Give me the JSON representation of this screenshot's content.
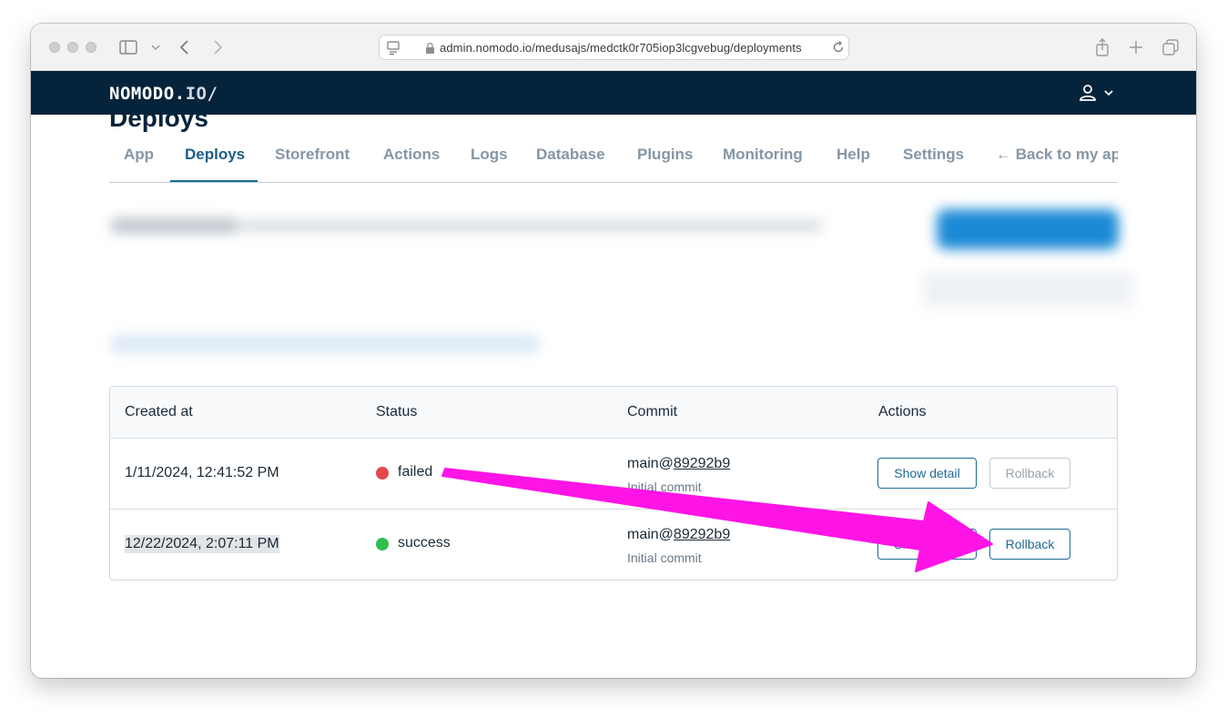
{
  "browser": {
    "url": "admin.nomodo.io/medusajs/medctk0r705iop3lcgvebug/deployments"
  },
  "app": {
    "logo_main": "NOMODO.",
    "logo_accent": "IO/"
  },
  "page": {
    "heading": "Deploys"
  },
  "tabs": [
    {
      "label": "App"
    },
    {
      "label": "Deploys"
    },
    {
      "label": "Storefront"
    },
    {
      "label": "Actions"
    },
    {
      "label": "Logs"
    },
    {
      "label": "Database"
    },
    {
      "label": "Plugins"
    },
    {
      "label": "Monitoring"
    },
    {
      "label": "Help"
    },
    {
      "label": "Settings"
    },
    {
      "label": "← Back to my ap"
    }
  ],
  "table": {
    "headers": [
      "Created at",
      "Status",
      "Commit",
      "Actions"
    ],
    "rows": [
      {
        "created_at": "1/11/2024, 12:41:52 PM",
        "status": "failed",
        "status_color": "#e5484d",
        "commit_prefix": "main@",
        "commit_hash": "89292b9",
        "commit_message": "Initial commit",
        "show_detail_label": "Show detail",
        "rollback_label": "Rollback",
        "rollback_enabled": false
      },
      {
        "created_at": "12/22/2024, 2:07:11 PM",
        "status": "success",
        "status_color": "#2fbf4f",
        "commit_prefix": "main@",
        "commit_hash": "89292b9",
        "commit_message": "Initial commit",
        "show_detail_label": "Show detail",
        "rollback_label": "Rollback",
        "rollback_enabled": true
      }
    ]
  },
  "colors": {
    "nav_bg": "#05233a",
    "accent": "#1d6a93",
    "annotation_arrow": "#ff14e6"
  }
}
